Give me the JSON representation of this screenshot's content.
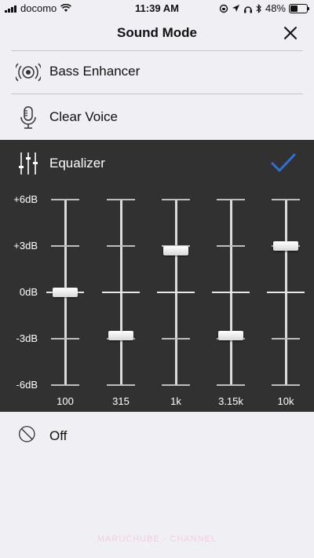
{
  "status": {
    "carrier": "docomo",
    "time": "11:39 AM",
    "battery": "48%",
    "battery_level": 0.48
  },
  "nav": {
    "title": "Sound Mode",
    "close_icon": "close-icon"
  },
  "modes": [
    {
      "label": "Bass Enhancer",
      "icon": "speaker-icon"
    },
    {
      "label": "Clear Voice",
      "icon": "microphone-icon"
    },
    {
      "label": "Equalizer",
      "icon": "sliders-icon",
      "selected": true
    },
    {
      "label": "Off",
      "icon": "off-icon"
    }
  ],
  "equalizer": {
    "db_labels": [
      "+6dB",
      "+3dB",
      "0dB",
      "-3dB",
      "-6dB"
    ],
    "range_db": [
      -6,
      6
    ],
    "bands": [
      {
        "freq": "100",
        "gain_db": 0
      },
      {
        "freq": "315",
        "gain_db": -2.8
      },
      {
        "freq": "1k",
        "gain_db": 2.7
      },
      {
        "freq": "3.15k",
        "gain_db": -2.8
      },
      {
        "freq": "10k",
        "gain_db": 3.0
      }
    ]
  },
  "colors": {
    "accent": "#2f6fd6",
    "panel": "#313131",
    "background": "#efeff4"
  },
  "watermark": "MARUCHUBE · CHANNEL"
}
